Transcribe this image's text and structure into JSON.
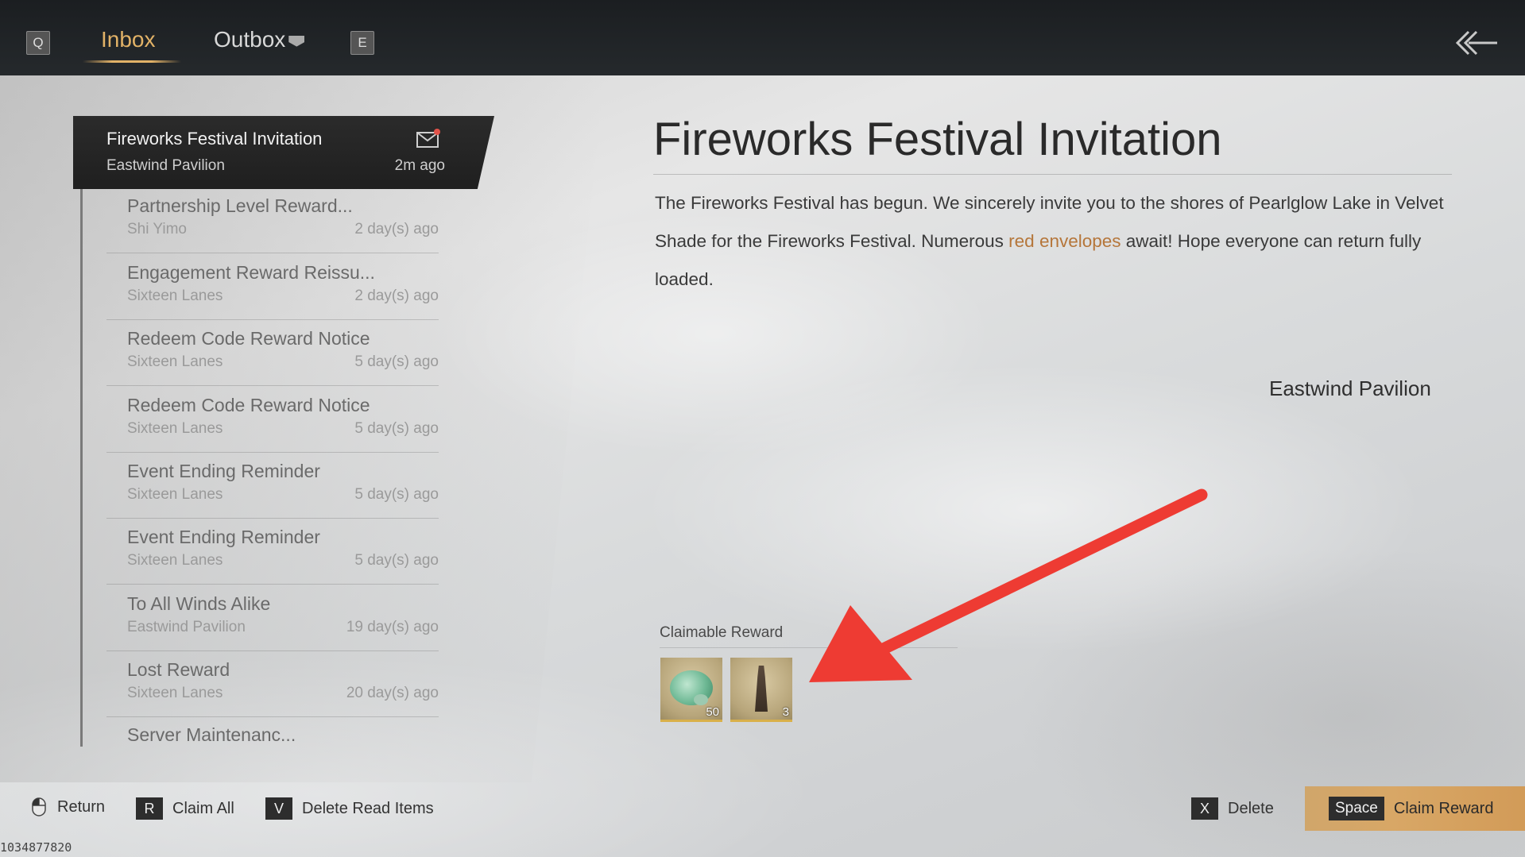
{
  "topbar": {
    "key_prev": "Q",
    "key_next": "E",
    "tabs": [
      {
        "label": "Inbox",
        "active": true
      },
      {
        "label": "Outbox",
        "active": false
      }
    ]
  },
  "mail_list": {
    "selected": {
      "title": "Fireworks Festival Invitation",
      "sender": "Eastwind Pavilion",
      "time": "2m ago"
    },
    "items": [
      {
        "title": "Partnership Level Reward...",
        "sender": "Shi Yimo",
        "time": "2 day(s) ago"
      },
      {
        "title": "Engagement Reward Reissu...",
        "sender": "Sixteen Lanes",
        "time": "2 day(s) ago"
      },
      {
        "title": "Redeem Code Reward Notice",
        "sender": "Sixteen Lanes",
        "time": "5 day(s) ago"
      },
      {
        "title": "Redeem Code Reward Notice",
        "sender": "Sixteen Lanes",
        "time": "5 day(s) ago"
      },
      {
        "title": "Event Ending Reminder",
        "sender": "Sixteen Lanes",
        "time": "5 day(s) ago"
      },
      {
        "title": "Event Ending Reminder",
        "sender": "Sixteen Lanes",
        "time": "5 day(s) ago"
      },
      {
        "title": "To All Winds Alike",
        "sender": "Eastwind Pavilion",
        "time": "19 day(s) ago"
      },
      {
        "title": "Lost Reward",
        "sender": "Sixteen Lanes",
        "time": "20 day(s) ago"
      },
      {
        "title": "Server Maintenanc...",
        "sender": "",
        "time": ""
      }
    ]
  },
  "detail": {
    "title": "Fireworks Festival Invitation",
    "body_before": "The Fireworks Festival has begun. We sincerely invite you to the shores of Pearlglow Lake in Velvet Shade for the Fireworks Festival. Numerous ",
    "body_highlight": "red envelopes",
    "body_after": " await! Hope everyone can return fully loaded.",
    "signature": "Eastwind Pavilion",
    "reward_label": "Claimable Reward",
    "rewards": [
      {
        "icon": "jade-disc-icon",
        "qty": "50"
      },
      {
        "icon": "figure-icon",
        "qty": "3"
      }
    ]
  },
  "bottom": {
    "return_label": "Return",
    "claim_all_key": "R",
    "claim_all_label": "Claim All",
    "delete_read_key": "V",
    "delete_read_label": "Delete Read Items",
    "delete_key": "X",
    "delete_label": "Delete",
    "claim_key": "Space",
    "claim_label": "Claim Reward"
  },
  "uid": "1034877820",
  "colors": {
    "accent": "#e2b267",
    "highlight": "#b5763a",
    "arrow": "#ee3b33",
    "claim_button": "#d8a766"
  }
}
